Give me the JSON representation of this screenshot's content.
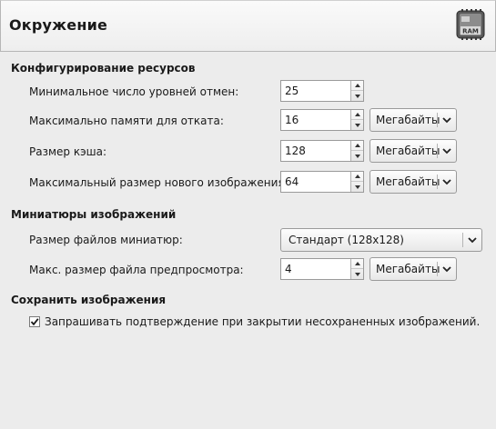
{
  "header": {
    "title": "Окружение",
    "icon": "ram-chip-icon",
    "icon_label": "RAM"
  },
  "sections": {
    "resources": {
      "title": "Конфигурирование ресурсов",
      "undo_levels": {
        "label": "Минимальное число уровней отмен:",
        "value": "25"
      },
      "undo_memory": {
        "label": "Максимально памяти для отката:",
        "value": "16",
        "unit": "Мегабайты"
      },
      "tile_cache": {
        "label": "Размер кэша:",
        "value": "128",
        "unit": "Мегабайты"
      },
      "max_new_image": {
        "label": "Максимальный размер нового изображения:",
        "value": "64",
        "unit": "Мегабайты"
      }
    },
    "thumbnails": {
      "title": "Миниатюры изображений",
      "thumb_size": {
        "label": "Размер файлов миниатюр:",
        "value": "Стандарт (128x128)"
      },
      "max_preview_size": {
        "label": "Макс. размер файла предпросмотра:",
        "value": "4",
        "unit": "Мегабайты"
      }
    },
    "save": {
      "title": "Сохранить изображения",
      "confirm_close": {
        "label": "Запрашивать подтверждение при закрытии несохраненных изображений.",
        "checked": true
      }
    }
  }
}
